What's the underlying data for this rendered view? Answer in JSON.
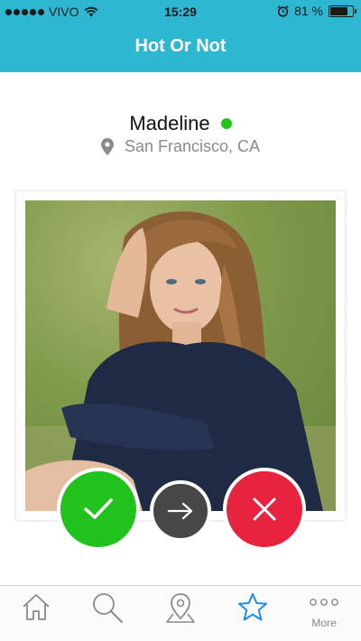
{
  "status_bar": {
    "carrier": "VIVO",
    "time": "15:29",
    "battery_percent": "81 %",
    "battery_level": 0.81
  },
  "nav": {
    "title": "Hot Or Not"
  },
  "profile": {
    "name": "Madeline",
    "online": true,
    "location": "San Francisco, CA"
  },
  "actions": {
    "hot_icon": "checkmark-icon",
    "skip_icon": "arrow-right-icon",
    "not_icon": "x-icon"
  },
  "tab_bar": {
    "items": [
      {
        "icon": "home-icon"
      },
      {
        "icon": "search-icon"
      },
      {
        "icon": "map-pin-icon"
      },
      {
        "icon": "star-icon",
        "active": true
      },
      {
        "icon": "more-icon",
        "label": "More"
      }
    ]
  },
  "colors": {
    "header": "#2db7d1",
    "online": "#21c21b",
    "hot": "#21c21b",
    "skip": "#474747",
    "not": "#e8233f",
    "active_tab": "#1d8ee8",
    "inactive_tab": "#8a8a8a"
  }
}
